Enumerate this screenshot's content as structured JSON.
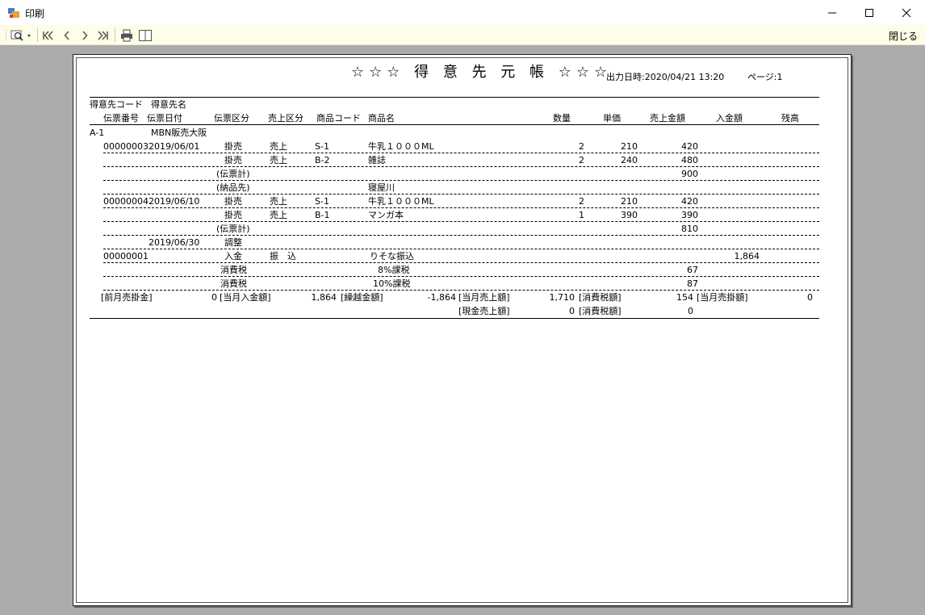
{
  "window": {
    "title": "印刷"
  },
  "toolbar": {
    "close_label": "閉じる"
  },
  "report": {
    "title": "☆☆☆ 得 意 先 元 帳 ☆☆☆",
    "output_datetime": "出力日時:2020/04/21 13:20",
    "page_label": "ページ:1",
    "header_row1": [
      "得意先コード",
      "得意先名"
    ],
    "header_row2": {
      "denpyo_no": "伝票番号",
      "denpyo_date": "伝票日付",
      "denpyo_kubun": "伝票区分",
      "uriage_kubun": "売上区分",
      "shohin_code": "商品コード",
      "shohin_name": "商品名",
      "qty": "数量",
      "unit_price": "単価",
      "amount": "売上金額",
      "payment": "入金額",
      "balance": "残高"
    },
    "customer": {
      "code": "A-1",
      "name": "MBN販売大阪"
    },
    "rows": [
      {
        "no": "00000003",
        "date": "2019/06/01",
        "kubun": "掛売",
        "uri": "売上",
        "code": "S-1",
        "name": "牛乳１０００ML",
        "qty": "2",
        "price": "210",
        "amount": "420",
        "payment": ""
      },
      {
        "no": "",
        "date": "",
        "kubun": "掛売",
        "uri": "売上",
        "code": "B-2",
        "name": "雑誌",
        "qty": "2",
        "price": "240",
        "amount": "480",
        "payment": ""
      },
      {
        "no": "",
        "date": "",
        "kubun": "(伝票計)",
        "uri": "",
        "code": "",
        "name": "",
        "qty": "",
        "price": "",
        "amount": "900",
        "payment": ""
      },
      {
        "no": "",
        "date": "",
        "kubun": "(納品先)",
        "uri": "",
        "code": "",
        "name": "寝屋川",
        "qty": "",
        "price": "",
        "amount": "",
        "payment": ""
      },
      {
        "no": "00000004",
        "date": "2019/06/10",
        "kubun": "掛売",
        "uri": "売上",
        "code": "S-1",
        "name": "牛乳１０００ML",
        "qty": "2",
        "price": "210",
        "amount": "420",
        "payment": ""
      },
      {
        "no": "",
        "date": "",
        "kubun": "掛売",
        "uri": "売上",
        "code": "B-1",
        "name": "マンガ本",
        "qty": "1",
        "price": "390",
        "amount": "390",
        "payment": ""
      },
      {
        "no": "",
        "date": "",
        "kubun": "(伝票計)",
        "uri": "",
        "code": "",
        "name": "",
        "qty": "",
        "price": "",
        "amount": "810",
        "payment": ""
      },
      {
        "no": "",
        "date": "2019/06/30",
        "kubun": "調整",
        "uri": "",
        "code": "",
        "name": "",
        "qty": "",
        "price": "",
        "amount": "",
        "payment": ""
      },
      {
        "no": "00000001",
        "date": "",
        "kubun": "入金",
        "uri": "振　込",
        "code": "",
        "name": "りそな振込",
        "qty": "",
        "price": "",
        "amount": "",
        "payment": "1,864"
      },
      {
        "no": "",
        "date": "",
        "kubun": "消費税",
        "uri": "",
        "code": "",
        "name": "8%課税",
        "qty": "",
        "price": "",
        "amount": "67",
        "payment": ""
      },
      {
        "no": "",
        "date": "",
        "kubun": "消費税",
        "uri": "",
        "code": "",
        "name": "10%課税",
        "qty": "",
        "price": "",
        "amount": "87",
        "payment": ""
      }
    ],
    "summary1": {
      "prev_label": "[前月売掛金]",
      "prev_value": "0",
      "in_label": "[当月入金額]",
      "in_value": "1,864",
      "carry_label": "[繰越金額]",
      "carry_value": "-1,864",
      "sales_label": "[当月売上額]",
      "sales_value": "1,710",
      "tax_label": "[消費税額]",
      "tax_value": "154",
      "ar_label": "[当月売掛額]",
      "ar_value": "0"
    },
    "summary2": {
      "cash_label": "[現金売上額]",
      "cash_value": "0",
      "tax_label": "[消費税額]",
      "tax_value": "0"
    }
  }
}
